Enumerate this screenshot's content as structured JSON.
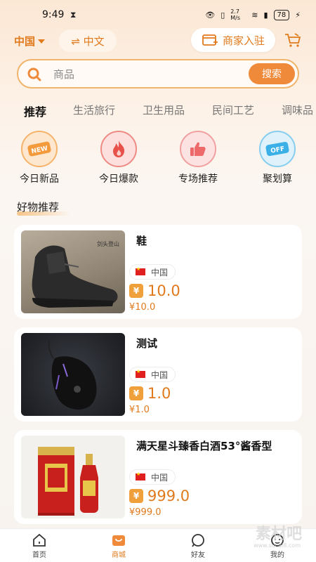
{
  "status": {
    "time": "9:49",
    "net": "2.7 M/s",
    "battery": "78"
  },
  "topbar": {
    "region": "中国",
    "language": "⇌ 中文",
    "merchant": "商家入驻"
  },
  "search": {
    "placeholder": "商品",
    "button": "搜索"
  },
  "tabs": [
    {
      "label": "推荐",
      "active": true
    },
    {
      "label": "生活旅行"
    },
    {
      "label": "卫生用品"
    },
    {
      "label": "民间工艺"
    },
    {
      "label": "调味品"
    }
  ],
  "categories": [
    {
      "label": "今日新品",
      "icon": "new-badge-icon",
      "color": "#f39a3c"
    },
    {
      "label": "今日爆款",
      "icon": "flame-icon",
      "color": "#e8504a"
    },
    {
      "label": "专场推荐",
      "icon": "thumbs-up-icon",
      "color": "#ee6a6a"
    },
    {
      "label": "聚划算",
      "icon": "off-tag-icon",
      "color": "#3bb0e6"
    }
  ],
  "section": {
    "title": "好物推荐"
  },
  "products": [
    {
      "name": "鞋",
      "origin": "中国",
      "price": "10.0",
      "sub_price": "¥10.0",
      "image_caption": "剑头登山"
    },
    {
      "name": "测试",
      "origin": "中国",
      "price": "1.0",
      "sub_price": "¥1.0"
    },
    {
      "name": "满天星斗臻香白酒53°酱香型",
      "origin": "中国",
      "price": "999.0",
      "sub_price": "¥999.0"
    }
  ],
  "nav": [
    {
      "label": "首页",
      "icon": "home-icon"
    },
    {
      "label": "商城",
      "icon": "shopping-bag-icon",
      "active": true
    },
    {
      "label": "好友",
      "icon": "friends-icon"
    },
    {
      "label": "我的",
      "icon": "profile-icon"
    }
  ],
  "watermark": {
    "brand": "素材吧",
    "url": "www.sucai8.com"
  },
  "colors": {
    "accent": "#e07a1c",
    "accent_button": "#ee8a3a",
    "border": "#f0b46a"
  }
}
